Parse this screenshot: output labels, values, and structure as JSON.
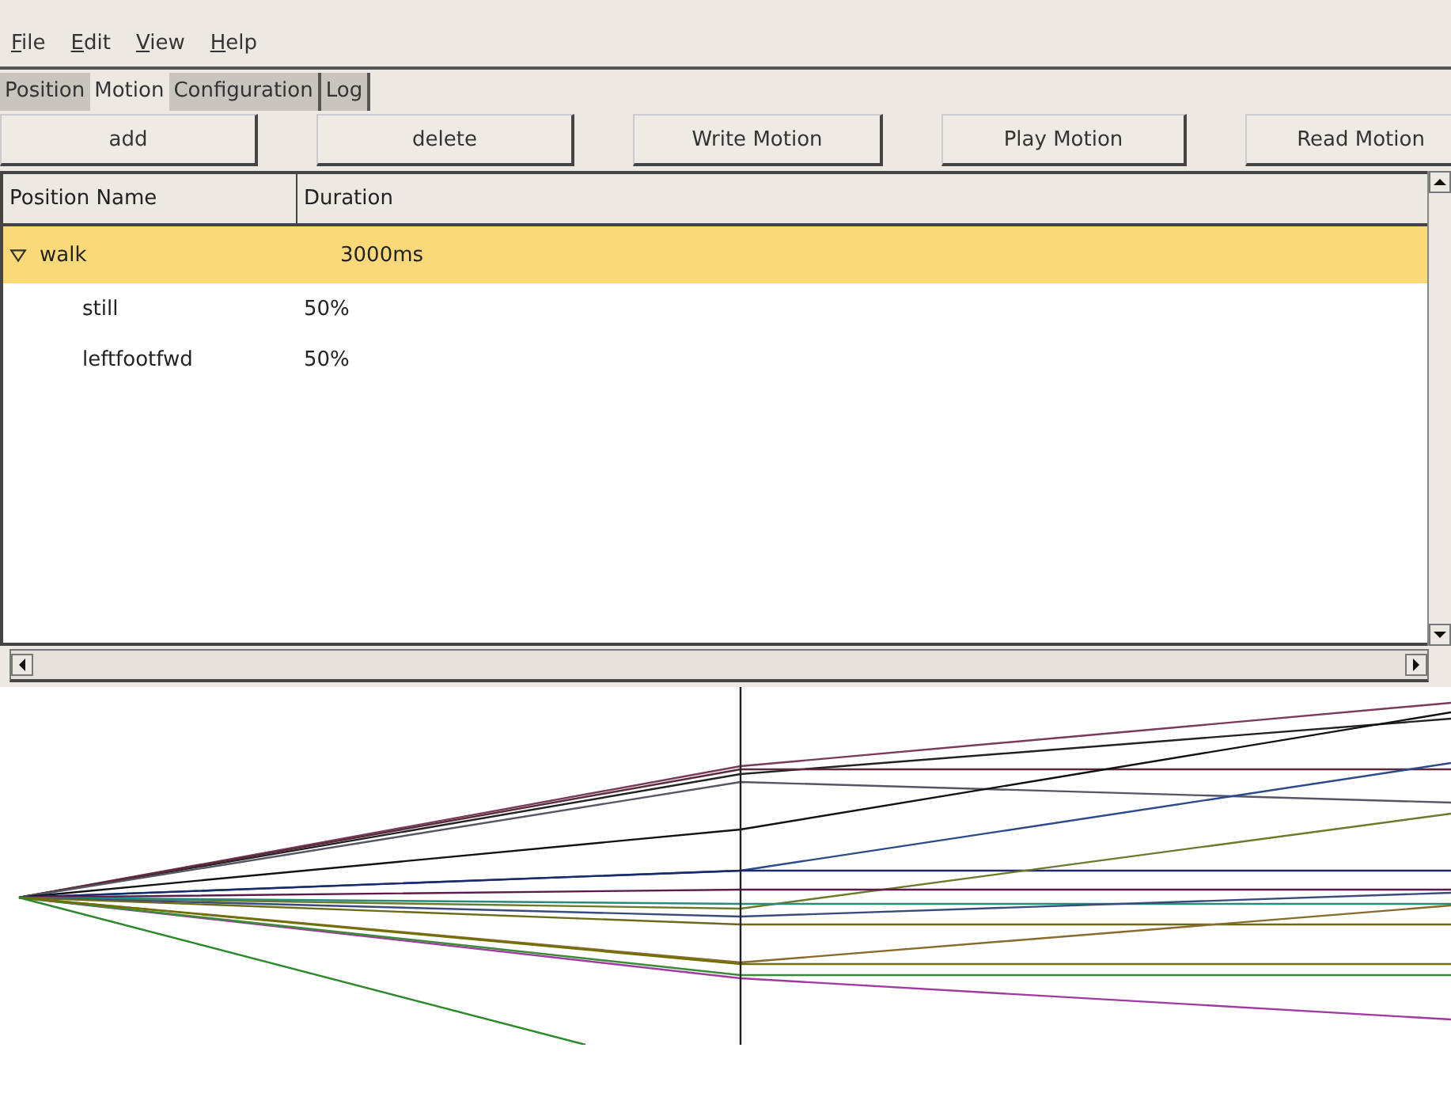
{
  "menu": [
    "File",
    "Edit",
    "View",
    "Help"
  ],
  "tabs": [
    {
      "label": "Position",
      "selected": false
    },
    {
      "label": "Motion",
      "selected": true
    },
    {
      "label": "Configuration",
      "selected": false
    },
    {
      "label": "Log",
      "selected": false
    }
  ],
  "buttons": [
    "add",
    "delete",
    "Write Motion",
    "Play Motion",
    "Read Motion"
  ],
  "tree": {
    "columns": [
      "Position Name",
      "Duration"
    ],
    "rows": [
      {
        "name": "walk",
        "duration": "3000ms",
        "selected": true,
        "expanded": true,
        "children": [
          {
            "name": "still",
            "duration": "50%",
            "selected": false
          },
          {
            "name": "leftfootfwd",
            "duration": "50%",
            "selected": false
          }
        ]
      }
    ]
  }
}
